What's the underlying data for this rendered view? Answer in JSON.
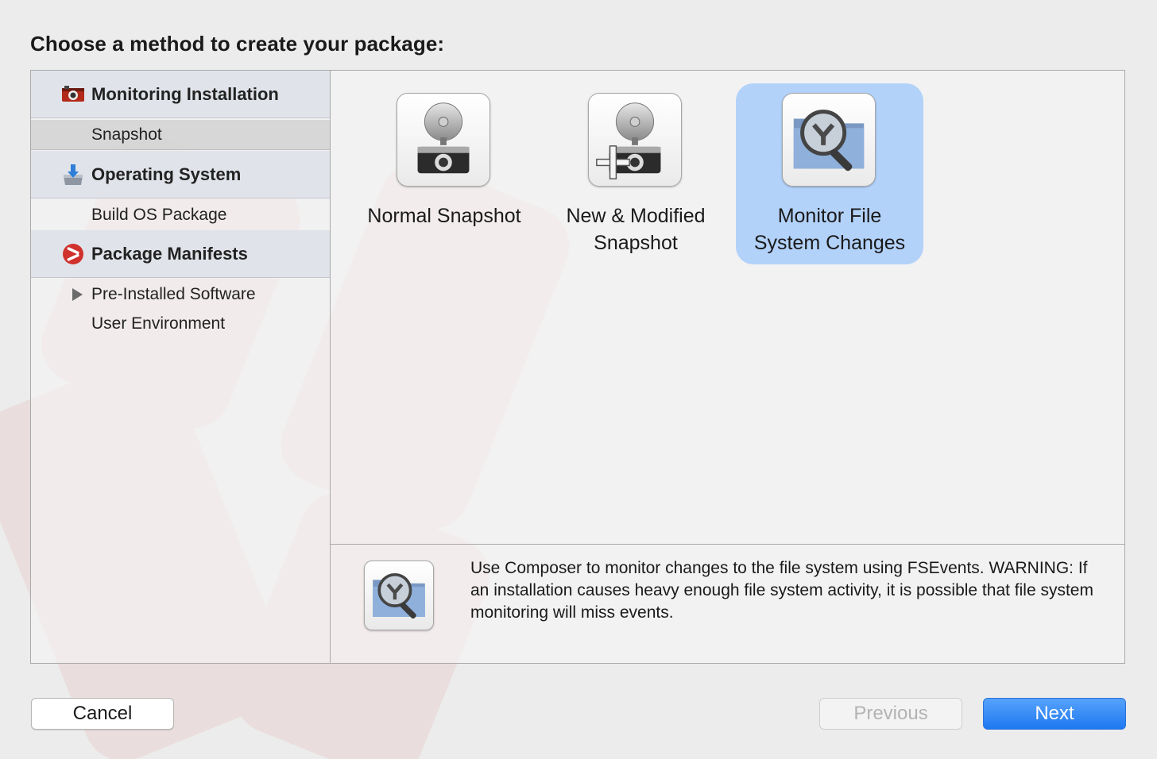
{
  "heading": "Choose a method to create your package:",
  "sidebar": {
    "groups": [
      {
        "label": "Monitoring Installation",
        "icon": "camera-icon",
        "items": [
          {
            "label": "Snapshot",
            "selected": true
          }
        ]
      },
      {
        "label": "Operating System",
        "icon": "installer-icon",
        "items": [
          {
            "label": "Build OS Package",
            "selected": false
          }
        ]
      },
      {
        "label": "Package Manifests",
        "icon": "jamf-icon",
        "items": [
          {
            "label": "Pre-Installed Software",
            "expandable": true
          },
          {
            "label": "User Environment"
          }
        ]
      }
    ]
  },
  "options": [
    {
      "label": "Normal Snapshot",
      "icon": "camera-flash-icon",
      "selected": false
    },
    {
      "label": "New  &  Modified\nSnapshot",
      "icon": "camera-flash-plus-icon",
      "selected": false
    },
    {
      "label": "Monitor File\nSystem Changes",
      "icon": "folder-magnifier-icon",
      "selected": true
    }
  ],
  "description": {
    "icon": "folder-magnifier-icon",
    "text": "Use Composer to monitor changes to the file system using FSEvents. WARNING: If an installation causes heavy enough file system activity, it is possible that file system monitoring will miss events."
  },
  "buttons": {
    "cancel": "Cancel",
    "previous": "Previous",
    "next": "Next"
  },
  "colors": {
    "accent": "#1e78f0",
    "selection": "#aacdfa",
    "watermark": "#c0392b"
  }
}
